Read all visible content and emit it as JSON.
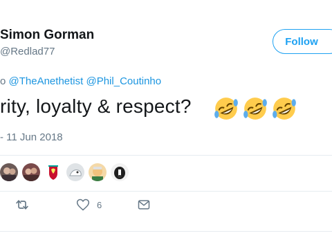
{
  "author": {
    "name": "Simon Gorman",
    "handle": "@Redlad77"
  },
  "follow_button": {
    "label": "Follow"
  },
  "reply_context": {
    "prefix": "o",
    "mentions": [
      "@TheAnethetist",
      "@Phil_Coutinho"
    ]
  },
  "tweet": {
    "text": "rity, loyalty & respect?",
    "emojis": [
      "rolling-on-floor-laughing",
      "rolling-on-floor-laughing",
      "rolling-on-floor-laughing"
    ]
  },
  "timestamp": "- 11 Jun 2018",
  "likers": [
    "avatar-1",
    "avatar-2",
    "avatar-liverpool-crest",
    "avatar-4",
    "avatar-5",
    "avatar-dog"
  ],
  "actions": {
    "retweet_count": "",
    "like_count": "6"
  },
  "colors": {
    "accent": "#1da1f2",
    "link": "#1b95e0",
    "muted": "#657786",
    "divider": "#e6ecf0"
  }
}
